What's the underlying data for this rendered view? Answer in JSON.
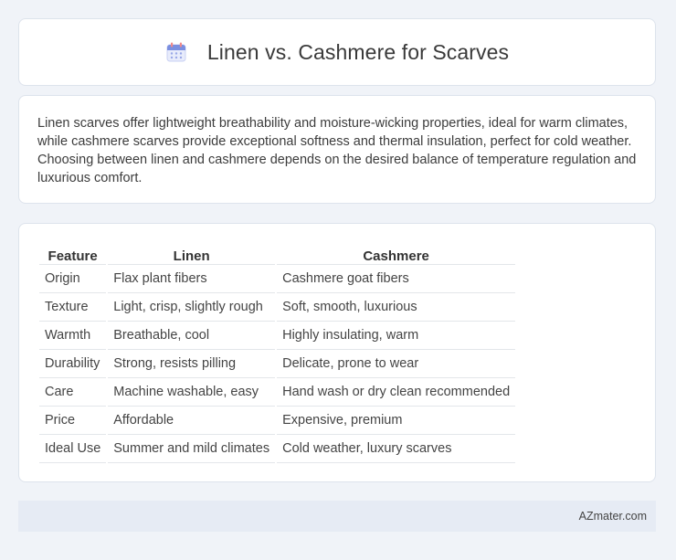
{
  "header": {
    "title": "Linen vs. Cashmere for Scarves",
    "icon": "calendar-icon"
  },
  "intro": {
    "text": "Linen scarves offer lightweight breathability and moisture-wicking properties, ideal for warm climates, while cashmere scarves provide exceptional softness and thermal insulation, perfect for cold weather. Choosing between linen and cashmere depends on the desired balance of temperature regulation and luxurious comfort."
  },
  "table": {
    "headers": [
      "Feature",
      "Linen",
      "Cashmere"
    ],
    "rows": [
      [
        "Origin",
        "Flax plant fibers",
        "Cashmere goat fibers"
      ],
      [
        "Texture",
        "Light, crisp, slightly rough",
        "Soft, smooth, luxurious"
      ],
      [
        "Warmth",
        "Breathable, cool",
        "Highly insulating, warm"
      ],
      [
        "Durability",
        "Strong, resists pilling",
        "Delicate, prone to wear"
      ],
      [
        "Care",
        "Machine washable, easy",
        "Hand wash or dry clean recommended"
      ],
      [
        "Price",
        "Affordable",
        "Expensive, premium"
      ],
      [
        "Ideal Use",
        "Summer and mild climates",
        "Cold weather, luxury scarves"
      ]
    ]
  },
  "footer": {
    "text": "AZmater.com"
  },
  "colors": {
    "background": "#f0f3f8",
    "card": "#ffffff",
    "footer": "#e6ebf4",
    "icon_accent": "#7b8fe0"
  }
}
